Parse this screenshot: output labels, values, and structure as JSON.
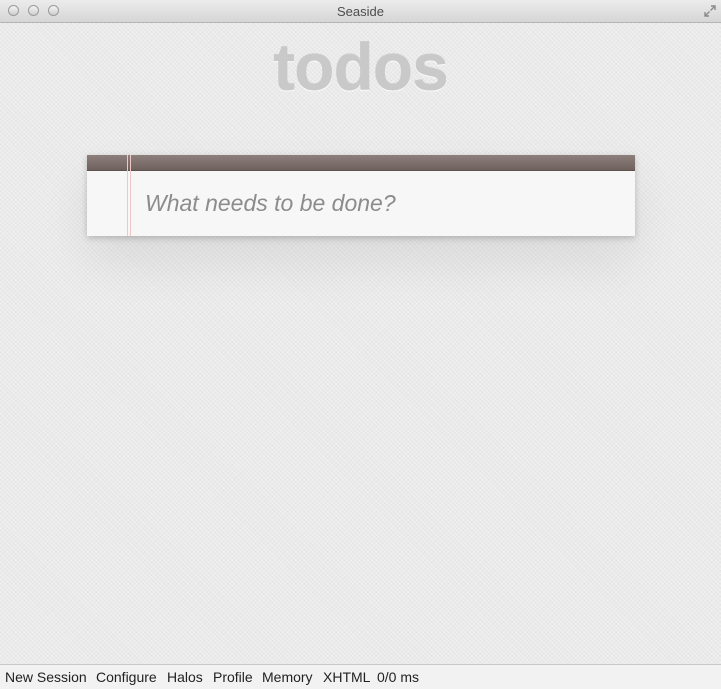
{
  "window": {
    "title": "Seaside"
  },
  "app": {
    "title": "todos",
    "new_todo_placeholder": "What needs to be done?",
    "new_todo_value": ""
  },
  "toolbar": {
    "items": [
      "New Session",
      "Configure",
      "Halos",
      "Profile",
      "Memory",
      "XHTML",
      "0/0 ms"
    ]
  },
  "colors": {
    "card_header": "#766964",
    "title_text": "#c9c9c9",
    "background": "#eaeaea"
  }
}
